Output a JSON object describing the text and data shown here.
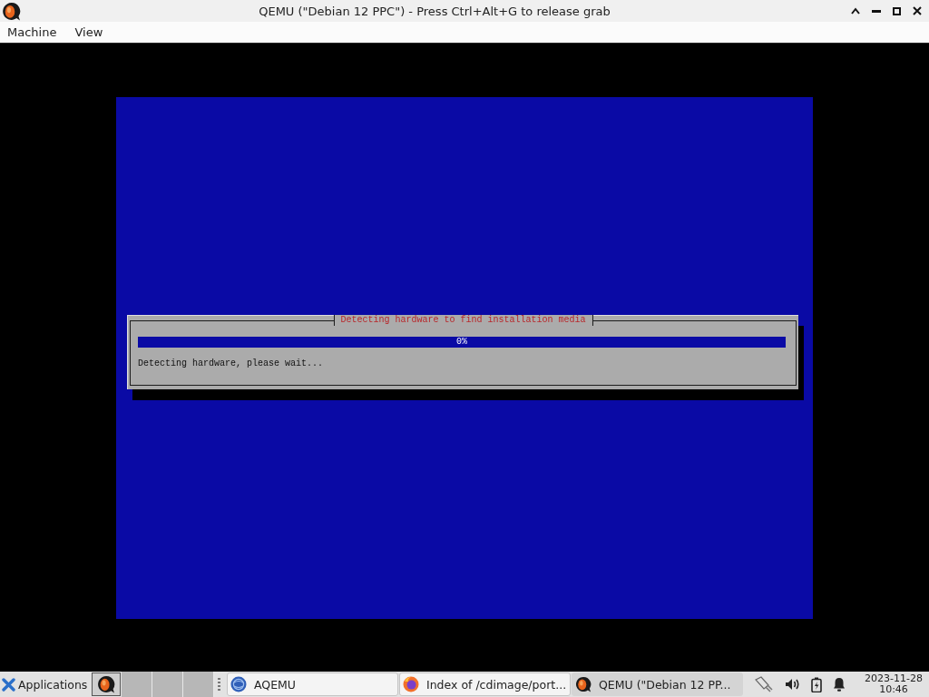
{
  "window": {
    "title": "QEMU (\"Debian 12 PPC\") - Press Ctrl+Alt+G to release grab"
  },
  "menu_bar": {
    "items": [
      "Machine",
      "View"
    ]
  },
  "installer": {
    "title": "Detecting hardware to find installation media",
    "progress": {
      "level": 0,
      "reading": "0%"
    },
    "message": "Detecting hardware, please wait..."
  },
  "taskbar": {
    "applications": "Applications",
    "tasks": [
      {
        "label": "AQEMU",
        "selected": false
      },
      {
        "label": "Index of /cdimage/port...",
        "selected": false
      },
      {
        "label": "QEMU (\"Debian 12 PP...",
        "selected": true
      }
    ],
    "clock": {
      "date": "2023-11-28",
      "time": "10:46"
    }
  }
}
